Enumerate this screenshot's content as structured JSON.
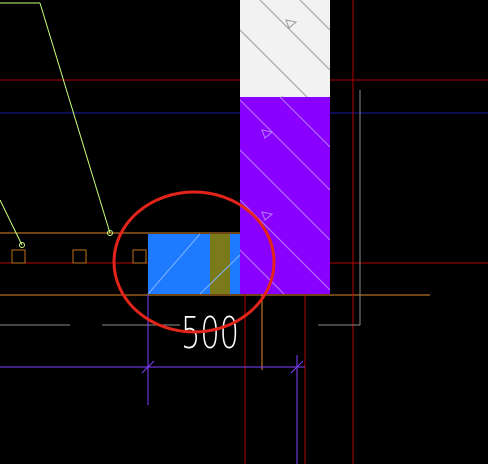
{
  "app": {
    "canvas_background": "#000000"
  },
  "drawing": {
    "dimension": {
      "text": "500",
      "color": "#ffffff",
      "line_color": "#7f3fff"
    },
    "highlight": {
      "markup_color": "#e3241b",
      "markup_shape": "ellipse"
    },
    "elements": {
      "white_block_color": "#f2f2f2",
      "purple_column_color": "#8a00ff",
      "blue_block_color": "#1e7bff",
      "olive_block_color": "#7a7a1a",
      "guide_line_red": "#b40000",
      "guide_line_blue": "#1a1aa6",
      "guide_line_orange": "#e08a2a",
      "leader_line_color": "#c8ff7a",
      "marker_color": "#c07020",
      "gray_line_color": "#8c8c8c"
    },
    "icons": [
      "triangle-marker-icon",
      "square-marker-icon",
      "node-circle-icon"
    ]
  }
}
